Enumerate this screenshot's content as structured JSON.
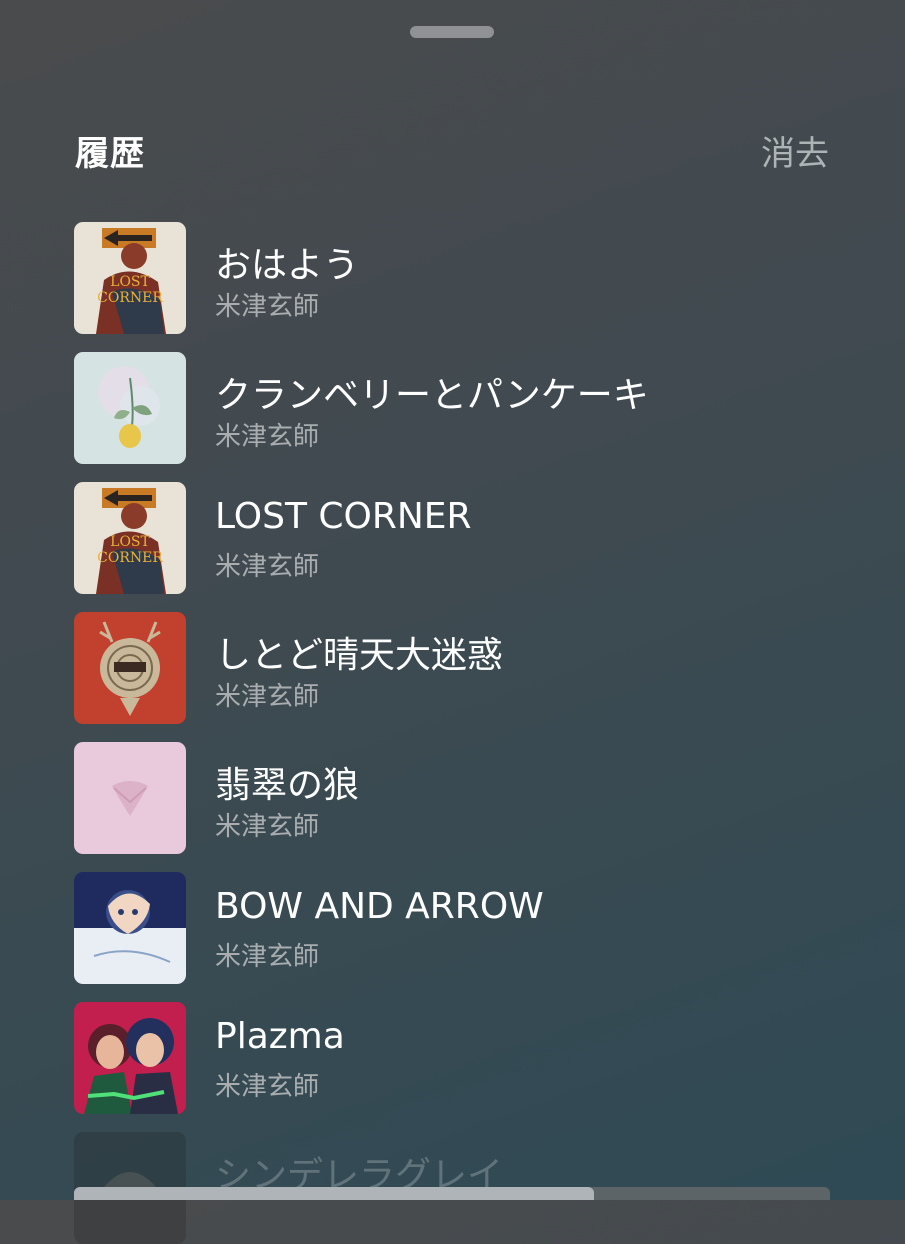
{
  "header": {
    "title": "履歴",
    "clear_label": "消去"
  },
  "tracks": [
    {
      "title": "おはよう",
      "artist": "米津玄師",
      "art": "lost-corner-art"
    },
    {
      "title": "クランベリーとパンケーキ",
      "artist": "米津玄師",
      "art": "lemon-art"
    },
    {
      "title": "LOST CORNER",
      "artist": "米津玄師",
      "art": "lost-corner-art"
    },
    {
      "title": "しとど晴天大迷惑",
      "artist": "米津玄師",
      "art": "yankee-art"
    },
    {
      "title": "翡翠の狼",
      "artist": "米津玄師",
      "art": "pink-art"
    },
    {
      "title": "BOW AND ARROW",
      "artist": "米津玄師",
      "art": "bow-and-arrow-art"
    },
    {
      "title": "Plazma",
      "artist": "米津玄師",
      "art": "plazma-art"
    },
    {
      "title": "シンデレラグレイ",
      "artist": "",
      "art": "cinderella-gray-art"
    }
  ],
  "colors": {
    "title": "#ffffff",
    "secondary": "#a9adb0",
    "clear": "#aeb3b6"
  },
  "scroll_position": 0.69
}
